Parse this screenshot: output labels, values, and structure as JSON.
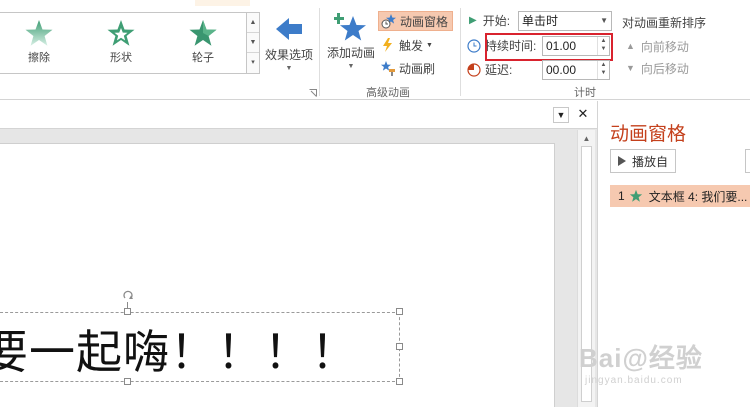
{
  "ribbon": {
    "effects": [
      {
        "label": "擦除",
        "icon": "wipe-star-icon"
      },
      {
        "label": "形状",
        "icon": "shape-star-icon"
      },
      {
        "label": "轮子",
        "icon": "wheel-star-icon"
      }
    ],
    "effect_options": {
      "label": "效果选项",
      "icon": "arrow-left-icon"
    },
    "advanced": {
      "add_animation": "添加动画",
      "animation_pane": "动画窗格",
      "trigger": "触发",
      "animation_painter": "动画刷",
      "group_label": "高级动画"
    },
    "timing": {
      "start_label": "开始:",
      "start_value": "单击时",
      "duration_label": "持续时间:",
      "duration_value": "01.00",
      "delay_label": "延迟:",
      "delay_value": "00.00",
      "group_label": "计时"
    },
    "reorder": {
      "title": "对动画重新排序",
      "move_earlier": "向前移动",
      "move_later": "向后移动"
    }
  },
  "slide": {
    "text": "要一起嗨！！！！"
  },
  "pane": {
    "title": "动画窗格",
    "play_button": "播放自",
    "items": [
      {
        "number": "1",
        "label": "文本框 4: 我们要..."
      }
    ]
  },
  "watermark": {
    "line1": "Bai@经验",
    "line2": "jingyan.baidu.com"
  },
  "colors": {
    "accent": "#c4401c",
    "selected": "#f6c9b0",
    "highlight_border": "#d9232e",
    "star_green": "#3f9e74"
  }
}
